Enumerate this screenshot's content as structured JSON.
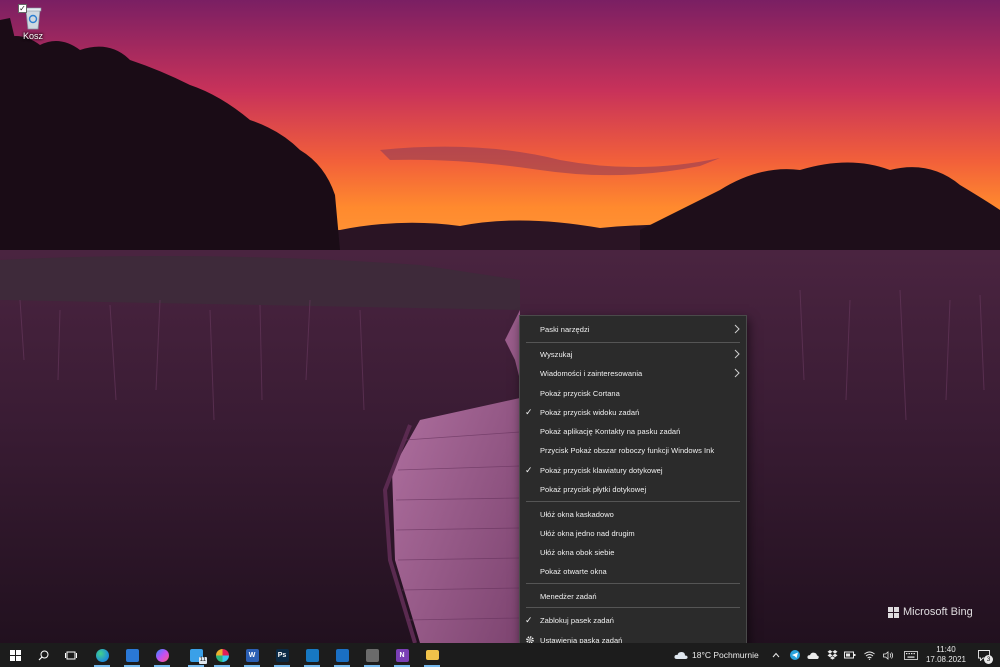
{
  "desktop": {
    "recycle_bin_label": "Kosz"
  },
  "watermark": {
    "text": "Microsoft Bing"
  },
  "context_menu": {
    "items": [
      {
        "label": "Paski narzędzi",
        "checked": false,
        "submenu": true
      },
      {
        "label": "Wyszukaj",
        "checked": false,
        "submenu": true
      },
      {
        "label": "Wiadomości i zainteresowania",
        "checked": false,
        "submenu": true
      },
      {
        "label": "Pokaż przycisk Cortana",
        "checked": false,
        "submenu": false
      },
      {
        "label": "Pokaż przycisk widoku zadań",
        "checked": true,
        "submenu": false
      },
      {
        "label": "Pokaż aplikację Kontakty na pasku zadań",
        "checked": false,
        "submenu": false
      },
      {
        "label": "Przycisk Pokaż obszar roboczy funkcji Windows Ink",
        "checked": false,
        "submenu": false
      },
      {
        "label": "Pokaż przycisk klawiatury dotykowej",
        "checked": true,
        "submenu": false
      },
      {
        "label": "Pokaż przycisk płytki dotykowej",
        "checked": false,
        "submenu": false
      },
      {
        "label": "Ułóż okna kaskadowo",
        "checked": false,
        "submenu": false
      },
      {
        "label": "Ułóż okna jedno nad drugim",
        "checked": false,
        "submenu": false
      },
      {
        "label": "Ułóż okna obok siebie",
        "checked": false,
        "submenu": false
      },
      {
        "label": "Pokaż otwarte okna",
        "checked": false,
        "submenu": false
      },
      {
        "label": "Menedżer zadań",
        "checked": false,
        "submenu": false
      },
      {
        "label": "Zablokuj pasek zadań",
        "checked": true,
        "submenu": false
      },
      {
        "label": "Ustawienia paska zadań",
        "checked": false,
        "submenu": false,
        "icon": "gear-icon"
      }
    ]
  },
  "taskbar": {
    "apps": [
      {
        "name": "edge",
        "icon": "edge-icon",
        "color": "#1f8fd8"
      },
      {
        "name": "mail",
        "icon": "mail-icon",
        "color": "#2a78d6"
      },
      {
        "name": "messenger",
        "icon": "messenger-icon",
        "color": "#a34df0"
      },
      {
        "name": "file-manager",
        "icon": "file-manager-icon",
        "color": "#3aa0e8",
        "badge": "11"
      },
      {
        "name": "slack",
        "icon": "slack-icon",
        "color": "#ffffff"
      },
      {
        "name": "word",
        "icon": "word-icon",
        "color": "#2b5fb4",
        "text": "W"
      },
      {
        "name": "photoshop",
        "icon": "photoshop-icon",
        "color": "#0b2a45",
        "text": "Ps"
      },
      {
        "name": "trello",
        "icon": "trello-icon",
        "color": "#1778c2"
      },
      {
        "name": "outlook",
        "icon": "outlook-icon",
        "color": "#1a6fc4"
      },
      {
        "name": "calculator",
        "icon": "calculator-icon",
        "color": "#6b6b6b"
      },
      {
        "name": "onenote",
        "icon": "onenote-icon",
        "color": "#7a3fb5",
        "text": "N"
      },
      {
        "name": "explorer",
        "icon": "folder-icon",
        "color": "#f0c24a"
      }
    ],
    "weather": "18°C  Pochmurnie",
    "clock": {
      "time": "11:40",
      "date": "17.08.2021"
    },
    "notifications_count": "3",
    "accent_color": "#76b9ed"
  }
}
